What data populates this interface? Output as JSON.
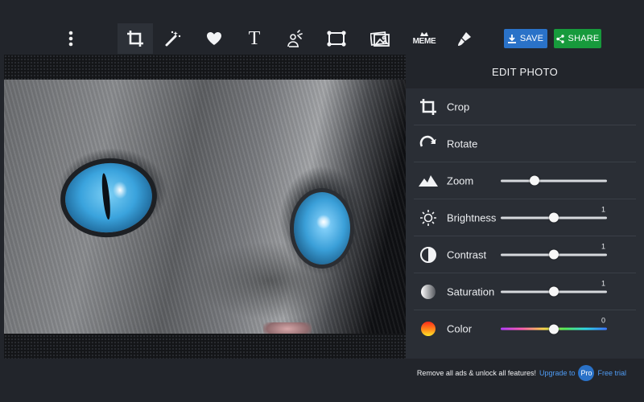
{
  "toolbar": {
    "tools": [
      {
        "name": "menu-icon"
      },
      {
        "name": "crop-tool-icon"
      },
      {
        "name": "magic-wand-icon"
      },
      {
        "name": "heart-icon"
      },
      {
        "name": "text-tool-icon",
        "label": "T"
      },
      {
        "name": "sticker-icon"
      },
      {
        "name": "frame-icon"
      },
      {
        "name": "image-overlay-icon"
      },
      {
        "name": "meme-icon",
        "label": "MEME"
      },
      {
        "name": "brush-icon"
      }
    ],
    "save_label": "SAVE",
    "share_label": "SHARE"
  },
  "panel": {
    "title": "EDIT PHOTO",
    "rows": [
      {
        "label": "Crop",
        "icon": "crop-icon"
      },
      {
        "label": "Rotate",
        "icon": "rotate-icon"
      },
      {
        "label": "Zoom",
        "icon": "zoom-icon",
        "slider": 0.32
      },
      {
        "label": "Brightness",
        "icon": "brightness-icon",
        "slider": 0.5,
        "value": "1"
      },
      {
        "label": "Contrast",
        "icon": "contrast-icon",
        "slider": 0.5,
        "value": "1"
      },
      {
        "label": "Saturation",
        "icon": "saturation-icon",
        "slider": 0.5,
        "value": "1"
      },
      {
        "label": "Color",
        "icon": "color-icon",
        "slider": 0.5,
        "value": "0"
      }
    ]
  },
  "footer": {
    "promo_text": "Remove all ads & unlock all features!",
    "upgrade_link": "Upgrade to",
    "pro_badge": "Pro",
    "trial_link": "Free trial"
  },
  "colors": {
    "background": "#22252b",
    "panel": "#2a2e35",
    "save": "#2a72c8",
    "share": "#179a3c",
    "link": "#4f9cf4"
  }
}
